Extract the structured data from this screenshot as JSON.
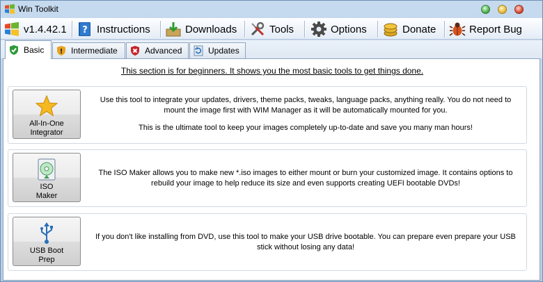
{
  "window": {
    "title": "Win Toolkit"
  },
  "menu": {
    "version": "v1.4.42.1",
    "items": [
      {
        "label": "Instructions",
        "icon": "help-book-icon"
      },
      {
        "label": "Downloads",
        "icon": "download-box-icon"
      },
      {
        "label": "Tools",
        "icon": "tools-icon"
      },
      {
        "label": "Options",
        "icon": "gear-icon"
      },
      {
        "label": "Donate",
        "icon": "coins-icon"
      },
      {
        "label": "Report Bug",
        "icon": "bug-icon"
      }
    ]
  },
  "tabs": [
    {
      "label": "Basic",
      "icon": "shield-check-icon",
      "active": true
    },
    {
      "label": "Intermediate",
      "icon": "shield-warning-icon",
      "active": false
    },
    {
      "label": "Advanced",
      "icon": "shield-stop-icon",
      "active": false
    },
    {
      "label": "Updates",
      "icon": "update-icon",
      "active": false
    }
  ],
  "basic": {
    "intro": "This section is for beginners. It shows you the most basic tools to get things done.",
    "tools": [
      {
        "button_label": "All-In-One\nIntegrator",
        "icon": "star-icon",
        "description_line1": "Use this tool to integrate your updates, drivers, theme packs, tweaks, language packs, anything really. You do not need to mount the image first with WIM Manager as it will be automatically mounted for you.",
        "description_line2": "This is the ultimate tool to keep your images completely up-to-date and save you many man hours!"
      },
      {
        "button_label": "ISO\nMaker",
        "icon": "disc-icon",
        "description_line1": "The ISO Maker allows you to make new *.iso images to either mount or burn your customized image. It contains options to rebuild your image to help reduce its size and even supports creating UEFI bootable DVDs!"
      },
      {
        "button_label": "USB Boot\nPrep",
        "icon": "usb-icon",
        "description_line1": "If you don't like installing from DVD, use this tool to make your USB drive bootable. You can prepare even prepare your USB stick without losing any data!"
      }
    ]
  },
  "colors": {
    "titlebar": "#c6daef",
    "menubar": "#f0f4fa",
    "panel": "#ffffff",
    "accent_blue": "#2a6fb8"
  }
}
